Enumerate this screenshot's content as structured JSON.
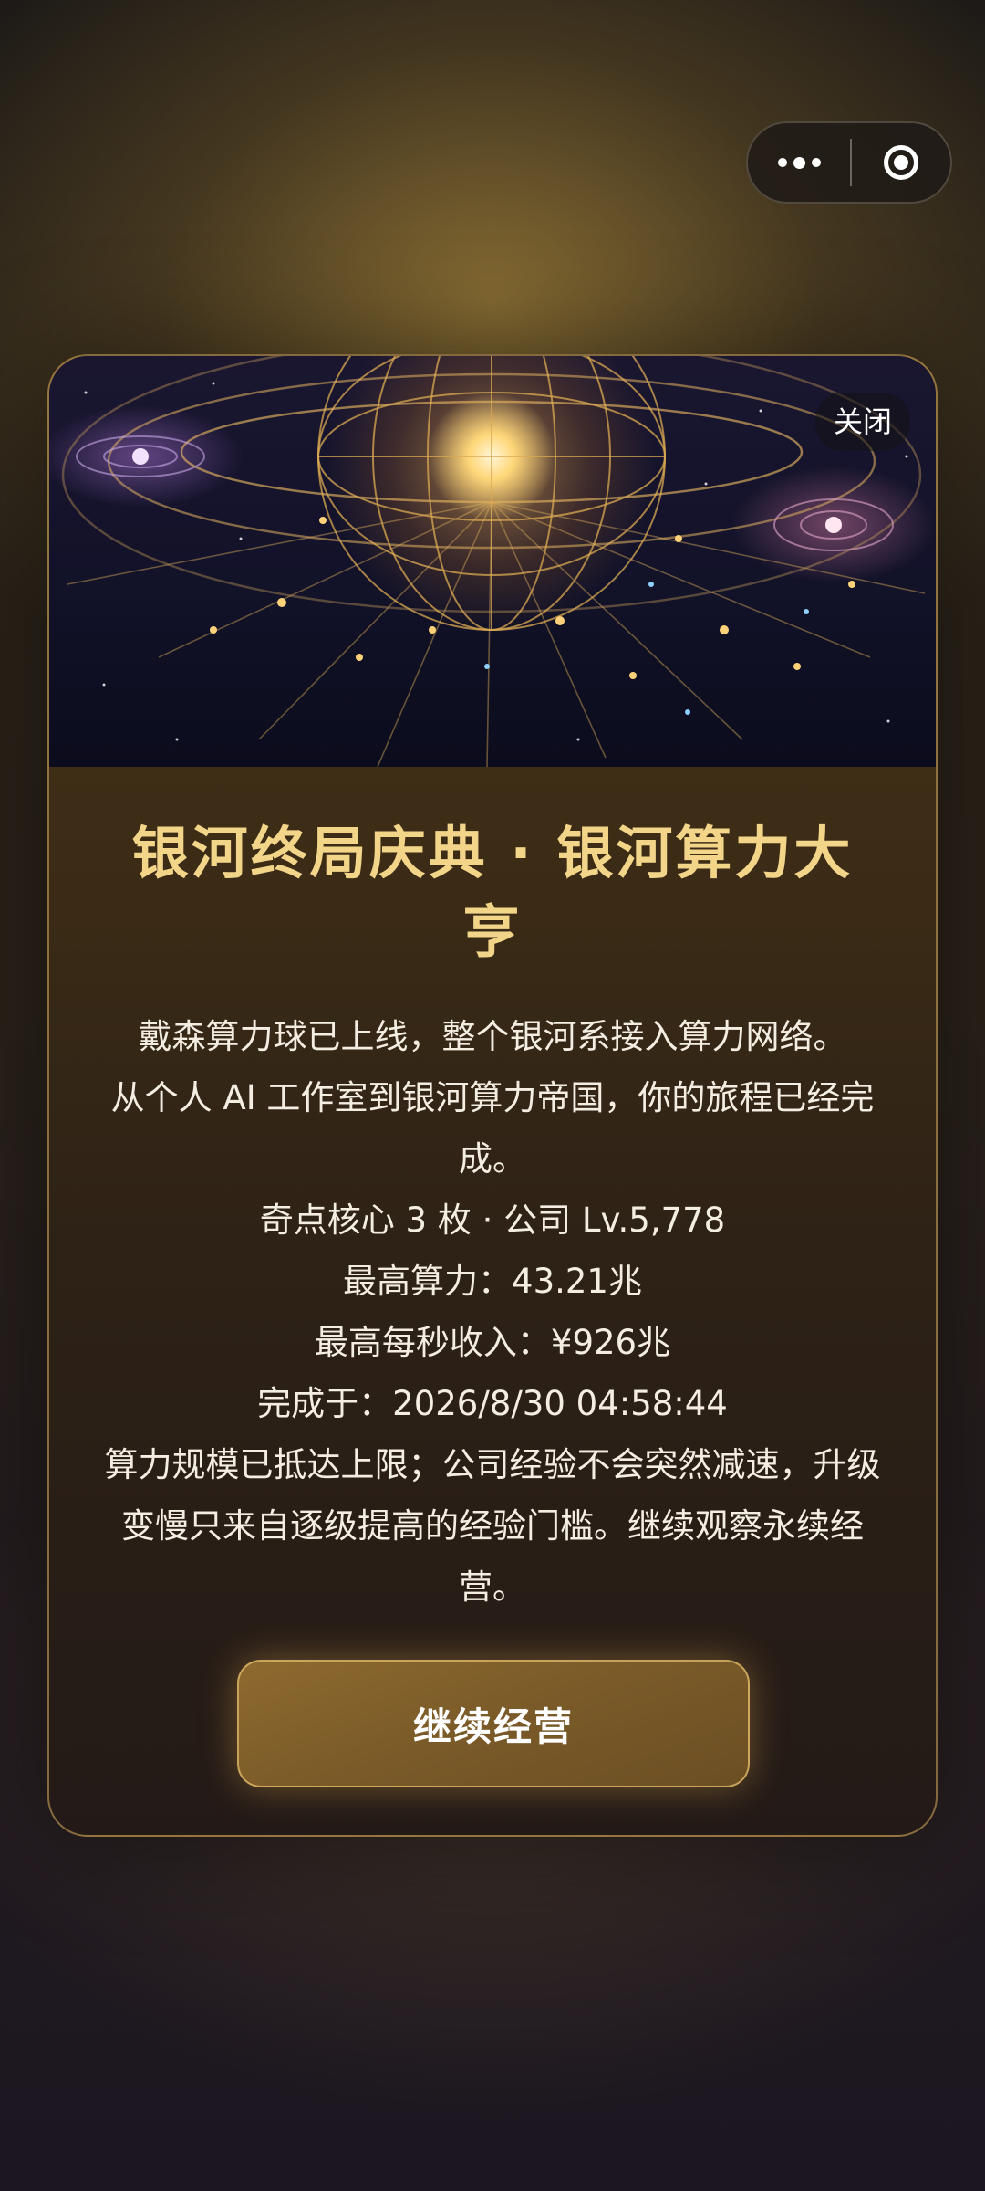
{
  "capsule": {
    "more_icon": "more-dots-icon",
    "close_icon": "target-circle-icon"
  },
  "modal": {
    "close_label": "关闭",
    "title": "银河终局庆典 · 银河算力大亨",
    "lines": [
      "戴森算力球已上线，整个银河系接入算力网络。",
      "从个人 AI 工作室到银河算力帝国，你的旅程已经完成。",
      "奇点核心 3 枚 · 公司 Lv.5,778",
      "最高算力：43.21兆",
      "最高每秒收入：¥926兆",
      "完成于：2026/8/30 04:58:44",
      "算力规模已抵达上限；公司经验不会突然减速，升级变慢只来自逐级提高的经验门槛。继续观察永续经营。"
    ],
    "continue_label": "继续经营"
  },
  "colors": {
    "title": "#f3d58a",
    "accent_border": "#c8a05a",
    "button": "#7a5a28"
  }
}
